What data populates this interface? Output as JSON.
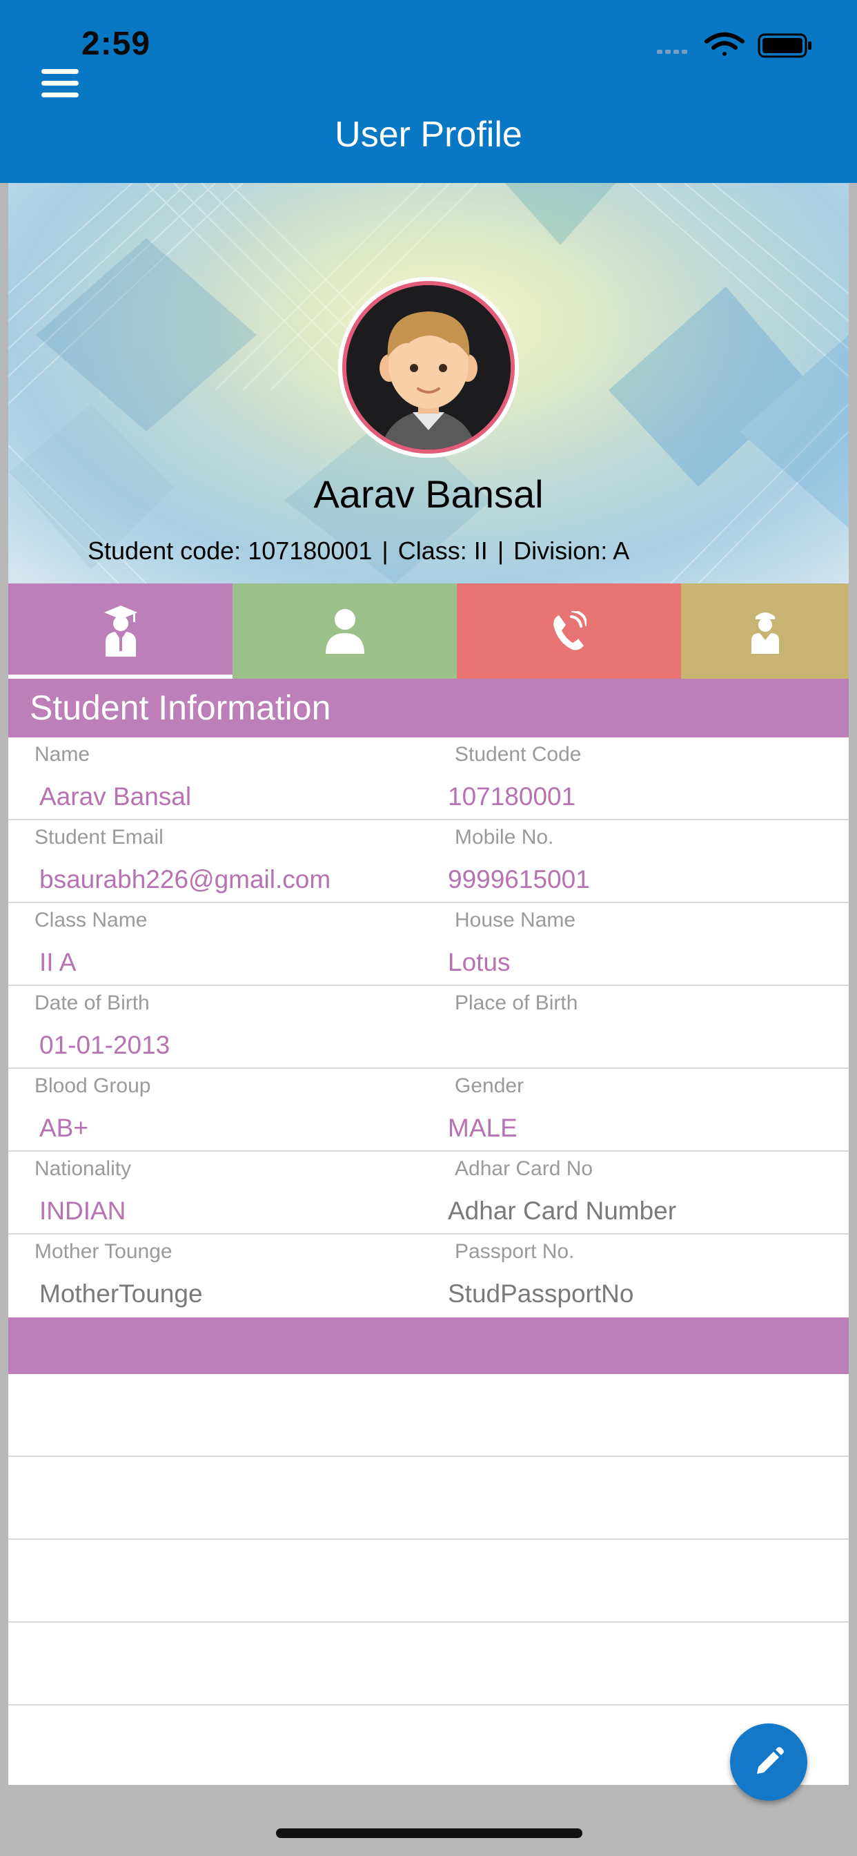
{
  "status_bar": {
    "time": "2:59"
  },
  "header": {
    "title": "User Profile"
  },
  "profile": {
    "name": "Aarav Bansal",
    "code_label": "Student code:",
    "code": "107180001",
    "class_label": "Class:",
    "class": "II",
    "division_label": "Division:",
    "division": "A"
  },
  "tabs": [
    {
      "icon": "graduate-icon"
    },
    {
      "icon": "person-icon"
    },
    {
      "icon": "phone-icon"
    },
    {
      "icon": "guardian-icon"
    }
  ],
  "section": {
    "title": "Student Information"
  },
  "rows": [
    {
      "left": {
        "label": "Name",
        "value": "Aarav Bansal"
      },
      "right": {
        "label": "Student Code",
        "value": "107180001"
      }
    },
    {
      "left": {
        "label": "Student Email",
        "value": "bsaurabh226@gmail.com"
      },
      "right": {
        "label": "Mobile No.",
        "value": "9999615001"
      }
    },
    {
      "left": {
        "label": "Class Name",
        "value": "II A"
      },
      "right": {
        "label": "House Name",
        "value": "Lotus"
      }
    },
    {
      "left": {
        "label": "Date of Birth",
        "value": "01-01-2013"
      },
      "right": {
        "label": "Place of Birth",
        "value": ""
      }
    },
    {
      "left": {
        "label": "Blood Group",
        "value": "AB+"
      },
      "right": {
        "label": "Gender",
        "value": "MALE"
      }
    },
    {
      "left": {
        "label": "Nationality",
        "value": "INDIAN"
      },
      "right": {
        "label": "Adhar Card No",
        "value": "Adhar Card Number"
      }
    },
    {
      "left": {
        "label": "Mother Tounge",
        "value": "MotherTounge"
      },
      "right": {
        "label": "Passport No.",
        "value": "StudPassportNo"
      }
    }
  ],
  "colors": {
    "header": "#0878c4",
    "accent_purple": "#bc7fb8",
    "tab_green": "#9cc08a",
    "tab_red": "#e87373",
    "tab_gold": "#c8b472",
    "fab": "#1478c8"
  }
}
